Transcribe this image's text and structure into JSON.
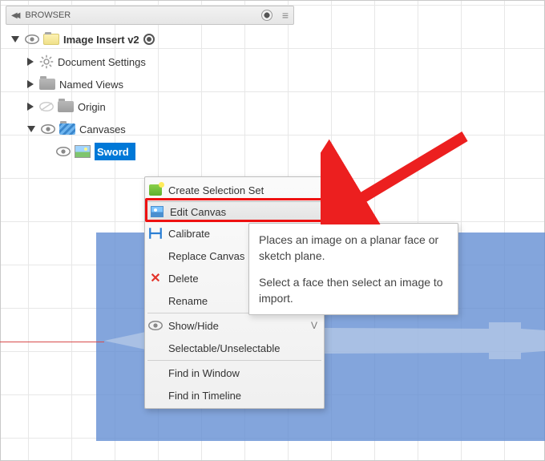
{
  "browser_panel": {
    "title": "BROWSER"
  },
  "tree": {
    "root": {
      "label": "Image Insert v2"
    },
    "doc_settings": {
      "label": "Document Settings"
    },
    "named_views": {
      "label": "Named Views"
    },
    "origin": {
      "label": "Origin"
    },
    "canvases": {
      "label": "Canvases"
    },
    "sword": {
      "label": "Sword"
    }
  },
  "context_menu": {
    "create_selection_set": "Create Selection Set",
    "edit_canvas": "Edit Canvas",
    "calibrate": "Calibrate",
    "replace_canvas": "Replace Canvas",
    "delete": "Delete",
    "rename": "Rename",
    "show_hide": "Show/Hide",
    "show_hide_shortcut": "V",
    "selectable": "Selectable/Unselectable",
    "find_window": "Find in Window",
    "find_timeline": "Find in Timeline"
  },
  "tooltip": {
    "line1": "Places an image on a planar face or sketch plane.",
    "line2": "Select a face then select an image to import."
  }
}
